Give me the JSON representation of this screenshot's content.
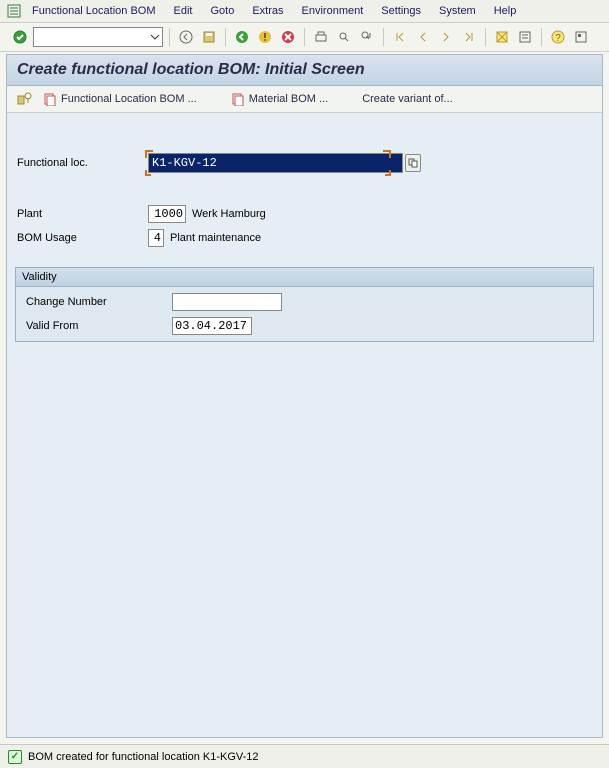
{
  "menu": {
    "items": [
      "Functional Location BOM",
      "Edit",
      "Goto",
      "Extras",
      "Environment",
      "Settings",
      "System",
      "Help"
    ]
  },
  "title": "Create functional location BOM: Initial Screen",
  "subtoolbar": {
    "funcloc_bom": "Functional Location BOM ...",
    "material_bom": "Material BOM ...",
    "create_variant": "Create variant of..."
  },
  "fields": {
    "functional_loc_label": "Functional loc.",
    "functional_loc_value": "K1-KGV-12",
    "plant_label": "Plant",
    "plant_value": "1000",
    "plant_desc": "Werk Hamburg",
    "bom_usage_label": "BOM Usage",
    "bom_usage_value": "4",
    "bom_usage_desc": "Plant maintenance"
  },
  "validity": {
    "title": "Validity",
    "change_number_label": "Change Number",
    "change_number_value": "",
    "valid_from_label": "Valid From",
    "valid_from_value": "03.04.2017"
  },
  "status": {
    "message": "BOM created for functional location K1-KGV-12"
  }
}
